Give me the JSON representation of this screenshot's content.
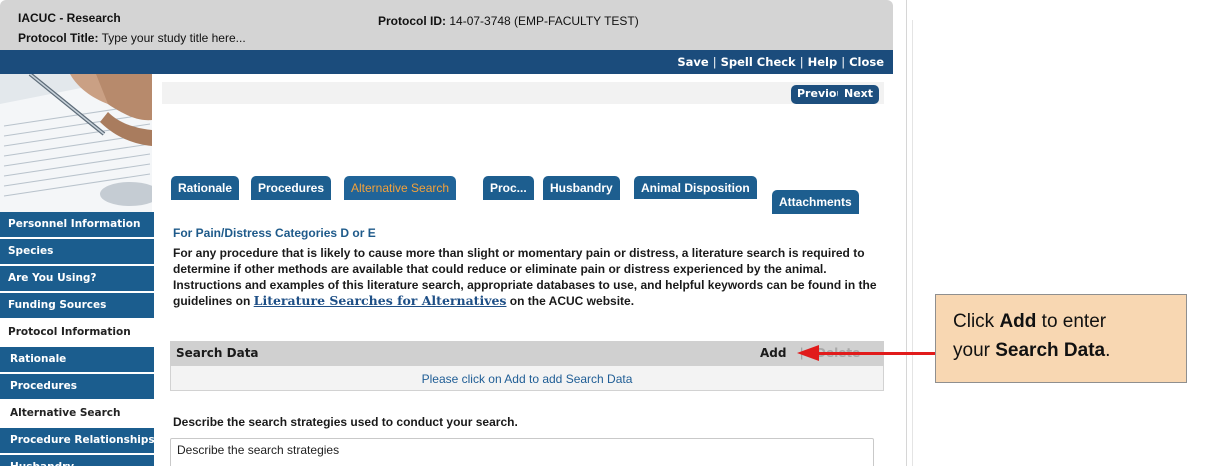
{
  "header": {
    "app_title": "IACUC - Research",
    "protocol_title_label": "Protocol Title:",
    "protocol_title_value": "Type your study title here...",
    "protocol_id_label": "Protocol ID:",
    "protocol_id_value": "14-07-3748 (EMP-FACULTY TEST)"
  },
  "top_actions": {
    "save": "Save",
    "spell_check": "Spell Check",
    "help": "Help",
    "close": "Close",
    "separator": "|"
  },
  "nav": {
    "previous": "Previous",
    "next": "Next"
  },
  "sidebar": {
    "items": [
      {
        "label": "Personnel Information"
      },
      {
        "label": "Species"
      },
      {
        "label": "Are You Using?"
      },
      {
        "label": "Funding Sources"
      },
      {
        "label": "Protocol Information"
      },
      {
        "label": "Rationale"
      },
      {
        "label": "Procedures"
      },
      {
        "label": "Alternative Search"
      },
      {
        "label": "Procedure Relationships"
      },
      {
        "label": "Husbandry"
      }
    ]
  },
  "tabs": [
    {
      "label": "Rationale"
    },
    {
      "label": "Procedures"
    },
    {
      "label": "Alternative Search"
    },
    {
      "label": "Proc..."
    },
    {
      "label": "Husbandry"
    },
    {
      "label": "Animal Disposition"
    },
    {
      "label": "Attachments"
    }
  ],
  "content": {
    "subtitle": "For Pain/Distress Categories D or E",
    "instructions_before_link": "For any procedure that is likely to cause more than slight or momentary pain or distress, a literature search is required to determine if other methods are available that could reduce or eliminate pain or distress experienced by the animal. Instructions and examples of this literature search, appropriate databases to use, and helpful keywords can be found in the guidelines on ",
    "instructions_link": "Literature Searches for Alternatives",
    "instructions_after_link": " on the ACUC website.",
    "search_data_title": "Search Data",
    "add_label": "Add",
    "separator": "|",
    "delete_label": "Delete",
    "empty_message": "Please click on Add to add Search Data",
    "strategy_label": "Describe the search strategies used to conduct your search.",
    "strategy_value": "Describe the search strategies"
  },
  "callout": {
    "line1_pre": "Click ",
    "line1_bold": "Add",
    "line1_post": " to enter",
    "line2_pre": "your ",
    "line2_bold": "Search Data",
    "line2_post": "."
  },
  "colors": {
    "primary_blue": "#1b4c7c",
    "tab_blue": "#1d5e8f",
    "active_tab_text": "#f3a13b",
    "callout_bg": "#f8d7b2",
    "arrow_red": "#e11b1b"
  },
  "icons": {
    "arrow": "left-arrow-icon"
  }
}
